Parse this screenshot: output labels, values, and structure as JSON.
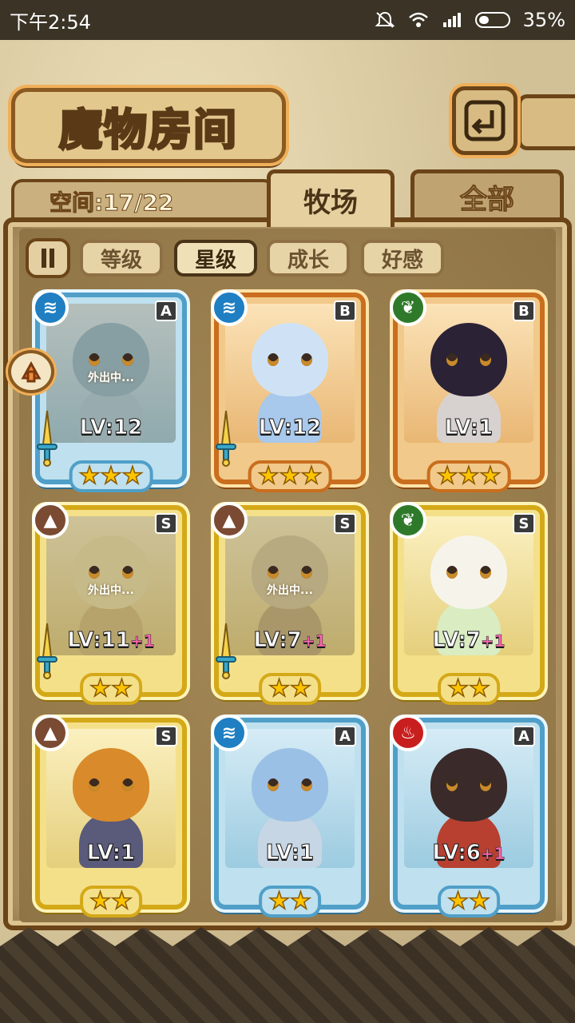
{
  "status": {
    "time": "下午2:54",
    "battery": "35%"
  },
  "header": {
    "title": "魔物房间",
    "space_label": "空间:17/22"
  },
  "tabs": [
    {
      "label": "牧场",
      "active": true
    },
    {
      "label": "全部",
      "active": false
    }
  ],
  "sort_buttons": [
    {
      "label": "等级"
    },
    {
      "label": "星级",
      "active": true
    },
    {
      "label": "成长"
    },
    {
      "label": "好感"
    }
  ],
  "away_text": "外出中...",
  "cards": [
    {
      "rank": "A",
      "element": "water",
      "level": "LV:12",
      "plus": "",
      "stars": 3,
      "away": true,
      "weapon": true,
      "frame": "a"
    },
    {
      "rank": "B",
      "element": "water",
      "level": "LV:12",
      "plus": "",
      "stars": 3,
      "away": false,
      "weapon": true,
      "frame": "b"
    },
    {
      "rank": "B",
      "element": "wood",
      "level": "LV:1",
      "plus": "",
      "stars": 3,
      "away": false,
      "weapon": false,
      "frame": "b"
    },
    {
      "rank": "S",
      "element": "earth",
      "level": "LV:11",
      "plus": "+1",
      "stars": 2,
      "away": true,
      "weapon": true,
      "frame": "s"
    },
    {
      "rank": "S",
      "element": "earth",
      "level": "LV:7",
      "plus": "+1",
      "stars": 2,
      "away": true,
      "weapon": true,
      "frame": "s"
    },
    {
      "rank": "S",
      "element": "wood",
      "level": "LV:7",
      "plus": "+1",
      "stars": 2,
      "away": false,
      "weapon": false,
      "frame": "s"
    },
    {
      "rank": "S",
      "element": "earth",
      "level": "LV:1",
      "plus": "",
      "stars": 2,
      "away": false,
      "weapon": false,
      "frame": "s"
    },
    {
      "rank": "A",
      "element": "water",
      "level": "LV:1",
      "plus": "",
      "stars": 2,
      "away": false,
      "weapon": false,
      "frame": "a"
    },
    {
      "rank": "A",
      "element": "fire",
      "level": "LV:6",
      "plus": "+1",
      "stars": 2,
      "away": false,
      "weapon": false,
      "frame": "a"
    }
  ]
}
